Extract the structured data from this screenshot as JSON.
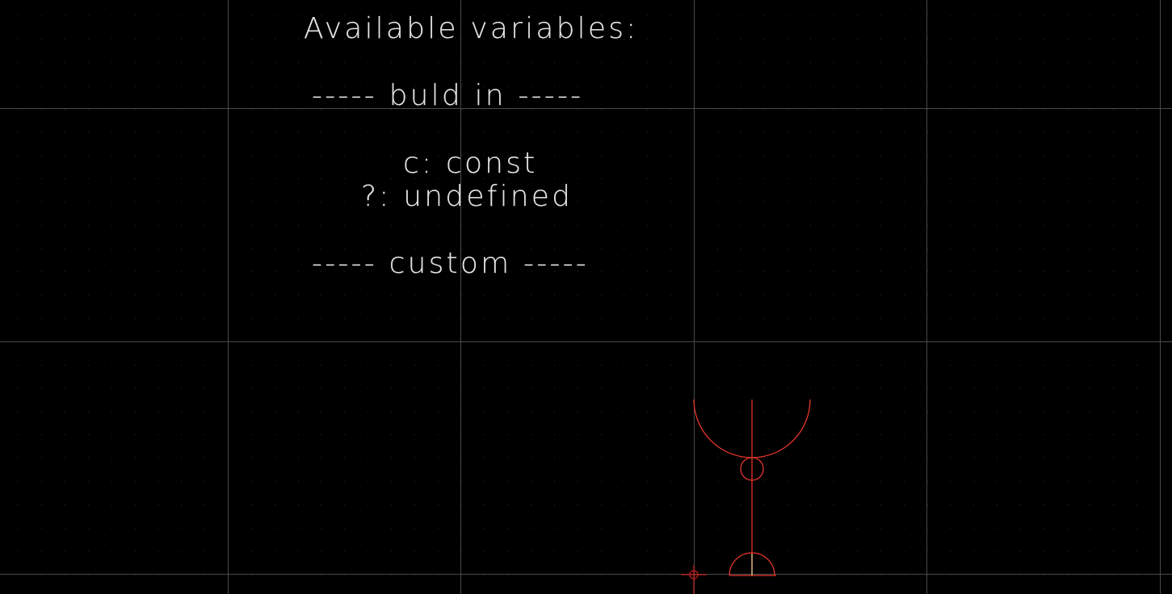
{
  "canvas": {
    "background_color": "#000000",
    "grid_dot_color": "#3a3a3a",
    "grid_line_color": "#4a4a4a",
    "shape_color": "#e8352c",
    "origin_marker_color": "#c0201a",
    "text_color": "#e4e4e4"
  },
  "text_items": {
    "title": "Available variables:",
    "builtin_header": "----- buld in -----",
    "const_line": "c: const",
    "undefined_line": "?: undefined",
    "custom_header": "----- custom -----"
  },
  "icons": {
    "origin_marker": "origin-crosshair-icon"
  }
}
